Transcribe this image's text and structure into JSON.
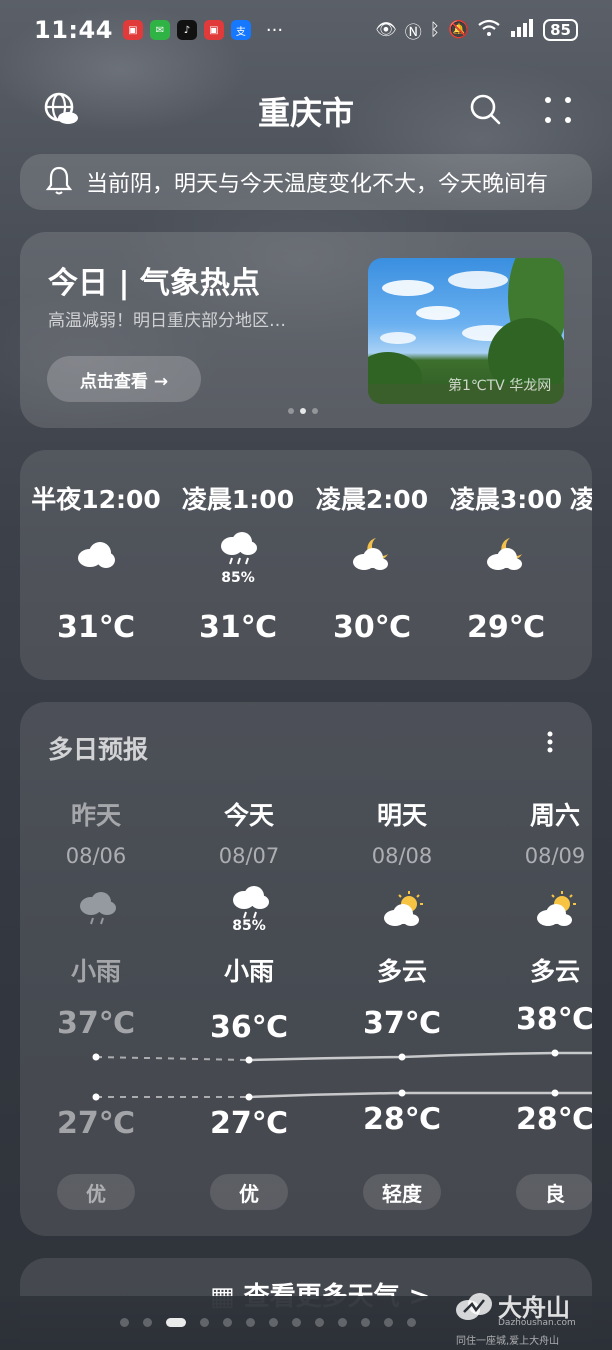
{
  "status_bar": {
    "time": "11:44",
    "battery": "85",
    "apps": [
      "huawei-app",
      "wechat",
      "tiktok",
      "huawei-app",
      "alipay"
    ]
  },
  "header": {
    "city": "重庆市"
  },
  "alert": {
    "text": "当前阴，明天与今天温度变化不大，今天晚间有"
  },
  "news": {
    "title": "今日 | 气象热点",
    "subtitle": "高温减弱！明日重庆部分地区…",
    "button_label": "点击查看 →",
    "image_caption": "第1℃TV 华龙网"
  },
  "hourly": [
    {
      "label": "半夜12:00",
      "icon": "cloudy-icon",
      "pop": "",
      "temp": "31℃"
    },
    {
      "label": "凌晨1:00",
      "icon": "rain-icon",
      "pop": "85%",
      "temp": "31℃"
    },
    {
      "label": "凌晨2:00",
      "icon": "night-cloudy-icon",
      "pop": "",
      "temp": "30℃"
    },
    {
      "label": "凌晨3:00",
      "icon": "night-cloudy-icon",
      "pop": "",
      "temp": "29℃"
    },
    {
      "label": "凌",
      "icon": "",
      "pop": "",
      "temp": ""
    }
  ],
  "daily": {
    "title": "多日预报",
    "days": [
      {
        "name": "昨天",
        "date": "08/06",
        "icon": "light-rain-icon",
        "pop": "",
        "condition": "小雨",
        "high": "37℃",
        "low": "27℃",
        "aqi": "优"
      },
      {
        "name": "今天",
        "date": "08/07",
        "icon": "light-rain-icon",
        "pop": "85%",
        "condition": "小雨",
        "high": "36℃",
        "low": "27℃",
        "aqi": "优"
      },
      {
        "name": "明天",
        "date": "08/08",
        "icon": "partly-cloudy-icon",
        "pop": "",
        "condition": "多云",
        "high": "37℃",
        "low": "28℃",
        "aqi": "轻度"
      },
      {
        "name": "周六",
        "date": "08/09",
        "icon": "partly-cloudy-icon",
        "pop": "",
        "condition": "多云",
        "high": "38℃",
        "low": "28℃",
        "aqi": "良"
      }
    ]
  },
  "more_weather": {
    "label": "查看更多天气 >"
  },
  "watermark": {
    "name": "大舟山",
    "url": "Dazhoushan.com",
    "slogan": "同住一座城,爱上大舟山"
  },
  "colors": {
    "sun": "#f6c343",
    "moon": "#f3c14b",
    "cloud": "#ffffff",
    "rain_cloud": "#c9cdd3"
  }
}
